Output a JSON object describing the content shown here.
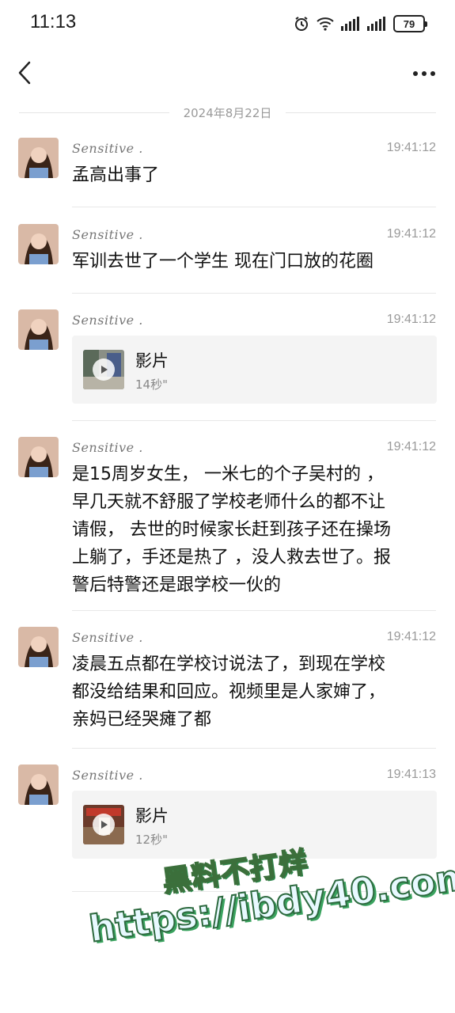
{
  "status_bar": {
    "time": "11:13",
    "battery": "79",
    "icons": [
      "alarm-icon",
      "wifi-icon",
      "signal-icon",
      "signal-icon",
      "battery-icon"
    ]
  },
  "nav": {
    "back_icon": "chevron-left-icon",
    "more_icon": "more-horizontal-icon"
  },
  "date_divider": "2024年8月22日",
  "messages": [
    {
      "sender": "Sensitive .",
      "time": "19:41:12",
      "text": "孟高出事了"
    },
    {
      "sender": "Sensitive .",
      "time": "19:41:12",
      "text": "军训去世了一个学生 现在门口放的花圈"
    },
    {
      "sender": "Sensitive .",
      "time": "19:41:12",
      "video": {
        "title": "影片",
        "duration": "14秒\""
      }
    },
    {
      "sender": "Sensitive .",
      "time": "19:41:12",
      "lines": [
        "是15周岁女生，  一米七的个子吴村的  ，",
        "早几天就不舒服了学校老师什么的都不让",
        "请假，  去世的时候家长赶到孩子还在操场",
        "上躺了，手还是热了  ，没人救去世了。报",
        "警后特警还是跟学校一伙的"
      ]
    },
    {
      "sender": "Sensitive .",
      "time": "19:41:12",
      "lines": [
        "凌晨五点都在学校讨说法了，到现在学校",
        "都没给结果和回应。视频里是人家婶了，",
        "亲妈已经哭瘫了都"
      ]
    },
    {
      "sender": "Sensitive .",
      "time": "19:41:13",
      "video": {
        "title": "影片",
        "duration": "12秒\""
      }
    }
  ],
  "watermark": {
    "line1": "黑料不打烊",
    "line2": "https://ibdy40.com"
  },
  "colors": {
    "background": "#ffffff",
    "card": "#f4f4f4",
    "meta_text": "#9a9a9a",
    "divider": "#e8e8e8"
  }
}
